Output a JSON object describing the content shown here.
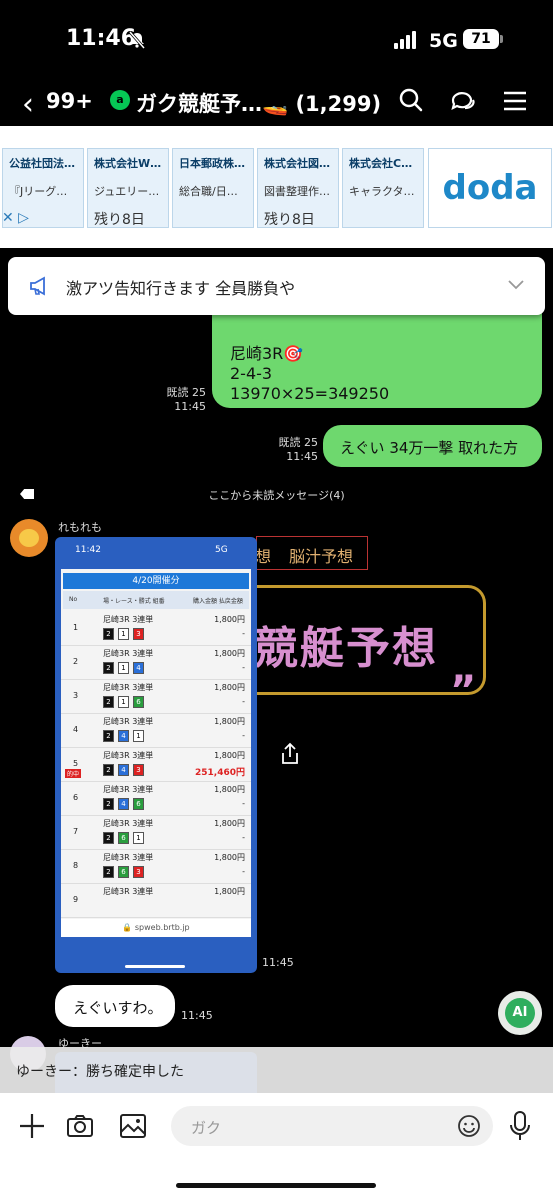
{
  "status_bar": {
    "time": "11:46",
    "network": "5G",
    "battery": "71"
  },
  "header": {
    "back_count": "99+",
    "official_badge": "a",
    "title": "ガク競艇予…🚤 (1,299)"
  },
  "ads": {
    "cards": [
      {
        "company": "公益社団法…",
        "desc": "『Jリーグ…",
        "tag": ""
      },
      {
        "company": "株式会社W…",
        "desc": "ジュエリー…",
        "tag": "残り8日"
      },
      {
        "company": "日本郵政株…",
        "desc": "総合職/日…",
        "tag": ""
      },
      {
        "company": "株式会社図…",
        "desc": "図書整理作…",
        "tag": "残り8日"
      },
      {
        "company": "株式会社C…",
        "desc": "キャラクタ…",
        "tag": ""
      }
    ],
    "brand": "doda"
  },
  "announcement": {
    "text": "激アツ告知行きます 全員勝負や",
    "hidden_time": "11:45"
  },
  "messages": {
    "m1": {
      "lines": [
        "尼崎3R🎯",
        "2-4-3",
        "13970×25=349250"
      ],
      "read": "既読 25",
      "time": "11:45"
    },
    "m2": {
      "text": "えぐい 34万一撃 取れた方",
      "read": "既読 25",
      "time": "11:45"
    },
    "unread_divider": "ここから未読メッセージ(4)",
    "m3": {
      "sender": "れもれも",
      "time": "11:45"
    },
    "m4": {
      "text": "えぐいすわ。",
      "time": "11:45"
    },
    "m5": {
      "sender": "ゆーきー"
    }
  },
  "screenshot": {
    "time": "11:42",
    "net": "5G",
    "header": "4/20開催分",
    "col_headers": [
      "No",
      "場・レース・勝式 組番",
      "購入金額 払戻金額"
    ],
    "rows": [
      {
        "no": "1",
        "race": "尼崎3R 3連単",
        "combo": "2-1-3",
        "amount": "1,800円",
        "payout": "-"
      },
      {
        "no": "2",
        "race": "尼崎3R 3連単",
        "combo": "2-1-4",
        "amount": "1,800円",
        "payout": "-"
      },
      {
        "no": "3",
        "race": "尼崎3R 3連単",
        "combo": "2-1-6",
        "amount": "1,800円",
        "payout": "-"
      },
      {
        "no": "4",
        "race": "尼崎3R 3連単",
        "combo": "2-4-1",
        "amount": "1,800円",
        "payout": "-"
      },
      {
        "no": "5",
        "race": "尼崎3R 3連単",
        "combo": "2-4-3",
        "amount": "1,800円",
        "payout": "251,460円",
        "hit": "的中"
      },
      {
        "no": "6",
        "race": "尼崎3R 3連単",
        "combo": "2-4-6",
        "amount": "1,800円",
        "payout": "-"
      },
      {
        "no": "7",
        "race": "尼崎3R 3連単",
        "combo": "2-6-1",
        "amount": "1,800円",
        "payout": "-"
      },
      {
        "no": "8",
        "race": "尼崎3R 3連単",
        "combo": "2-6-3",
        "amount": "1,800円",
        "payout": "-"
      },
      {
        "no": "9",
        "race": "尼崎3R 3連単",
        "combo": "",
        "amount": "1,800円",
        "payout": ""
      }
    ],
    "url": "spweb.brtb.jp"
  },
  "background_text": {
    "tab_left": "想",
    "tab_right": "脳汁予想",
    "big": "競艇予想"
  },
  "ai_button": "AI",
  "notice": {
    "text": "ゆーきー：勝ち確定申した"
  },
  "input": {
    "placeholder": "ガク"
  }
}
